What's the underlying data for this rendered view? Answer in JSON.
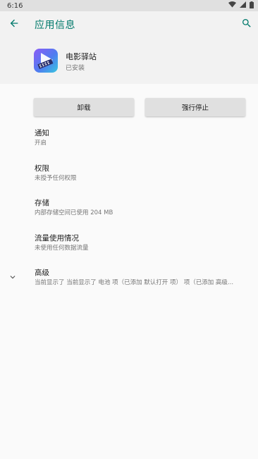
{
  "status_bar": {
    "time": "6:16",
    "icons": [
      "wifi-icon",
      "signal-icon",
      "battery-icon"
    ]
  },
  "app_bar": {
    "title": "应用信息",
    "back_icon": "arrow-back-icon",
    "search_icon": "search-icon"
  },
  "app": {
    "name": "电影驿站",
    "status": "已安装",
    "icon": "play-film-app-icon"
  },
  "buttons": {
    "uninstall": "卸载",
    "force_stop": "强行停止"
  },
  "preferences": [
    {
      "title": "通知",
      "summary": "开启"
    },
    {
      "title": "权限",
      "summary": "未授予任何权限"
    },
    {
      "title": "存储",
      "summary": "内部存储空间已使用 204 MB"
    },
    {
      "title": "流量使用情况",
      "summary": "未使用任何数据流量"
    },
    {
      "title": "高级",
      "summary": "当前显示了 当前显示了 电池 项（已添加 默认打开 项） 项（已添加 高级..."
    }
  ],
  "colors": {
    "accent": "#00796b",
    "header_bg": "#f2f2f2",
    "button_bg": "#e0e0e0",
    "status_bar_bg": "#e0e0e0"
  }
}
